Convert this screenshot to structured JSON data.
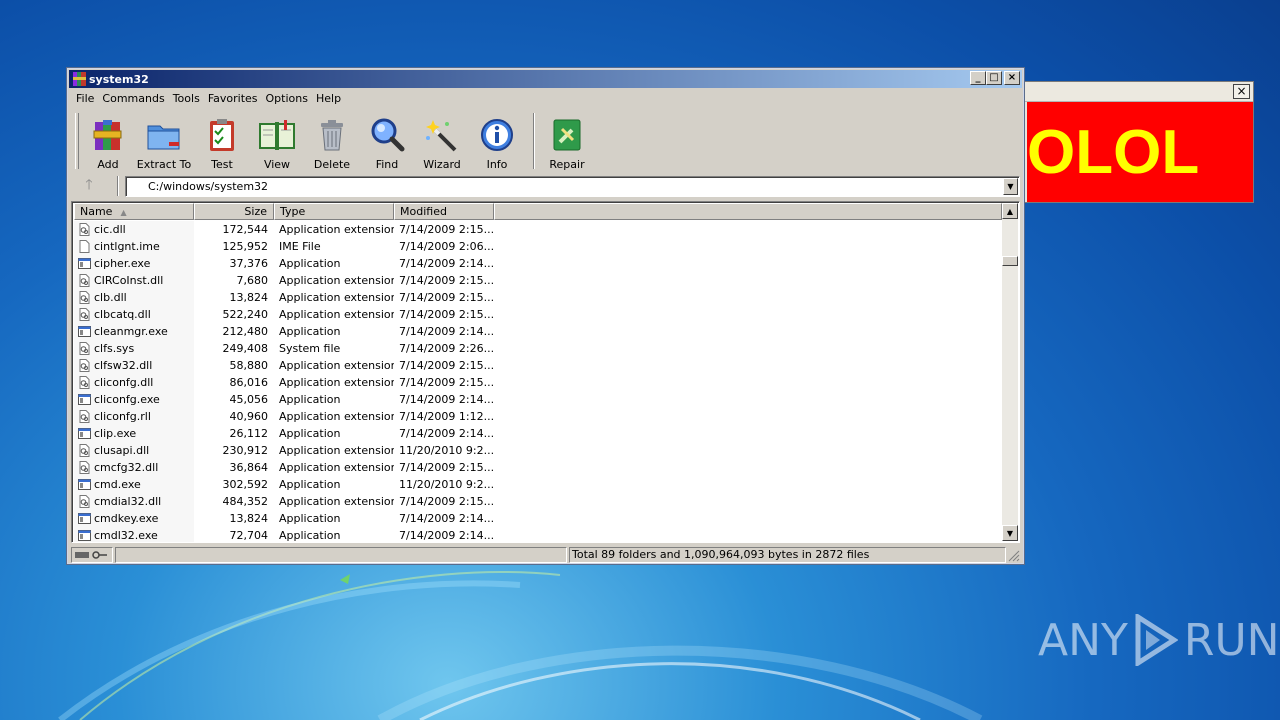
{
  "window": {
    "title": "system32",
    "minimize_glyph": "_",
    "maximize_glyph": "□",
    "close_glyph": "×"
  },
  "menu": [
    "File",
    "Commands",
    "Tools",
    "Favorites",
    "Options",
    "Help"
  ],
  "toolbar": {
    "buttons": [
      {
        "label": "Add",
        "icon": "add-archive-icon"
      },
      {
        "label": "Extract To",
        "icon": "extract-folder-icon"
      },
      {
        "label": "Test",
        "icon": "test-clipboard-icon"
      },
      {
        "label": "View",
        "icon": "view-book-icon"
      },
      {
        "label": "Delete",
        "icon": "delete-trash-icon"
      },
      {
        "label": "Find",
        "icon": "find-magnifier-icon"
      },
      {
        "label": "Wizard",
        "icon": "wizard-wand-icon"
      },
      {
        "label": "Info",
        "icon": "info-icon"
      },
      {
        "label": "Repair",
        "icon": "repair-kit-icon"
      }
    ]
  },
  "address": {
    "path": "C:/windows/system32",
    "up_glyph": "🡑"
  },
  "columns": {
    "name": "Name",
    "size": "Size",
    "type": "Type",
    "modified": "Modified"
  },
  "files": [
    {
      "name": "cic.dll",
      "size": "172,544",
      "type": "Application extension",
      "modified": "7/14/2009 2:15...",
      "icon": "dll"
    },
    {
      "name": "cintlgnt.ime",
      "size": "125,952",
      "type": "IME File",
      "modified": "7/14/2009 2:06...",
      "icon": "blank"
    },
    {
      "name": "cipher.exe",
      "size": "37,376",
      "type": "Application",
      "modified": "7/14/2009 2:14...",
      "icon": "exe"
    },
    {
      "name": "CIRCoInst.dll",
      "size": "7,680",
      "type": "Application extension",
      "modified": "7/14/2009 2:15...",
      "icon": "dll"
    },
    {
      "name": "clb.dll",
      "size": "13,824",
      "type": "Application extension",
      "modified": "7/14/2009 2:15...",
      "icon": "dll"
    },
    {
      "name": "clbcatq.dll",
      "size": "522,240",
      "type": "Application extension",
      "modified": "7/14/2009 2:15...",
      "icon": "dll"
    },
    {
      "name": "cleanmgr.exe",
      "size": "212,480",
      "type": "Application",
      "modified": "7/14/2009 2:14...",
      "icon": "exe"
    },
    {
      "name": "clfs.sys",
      "size": "249,408",
      "type": "System file",
      "modified": "7/14/2009 2:26...",
      "icon": "dll"
    },
    {
      "name": "clfsw32.dll",
      "size": "58,880",
      "type": "Application extension",
      "modified": "7/14/2009 2:15...",
      "icon": "dll"
    },
    {
      "name": "cliconfg.dll",
      "size": "86,016",
      "type": "Application extension",
      "modified": "7/14/2009 2:15...",
      "icon": "dll"
    },
    {
      "name": "cliconfg.exe",
      "size": "45,056",
      "type": "Application",
      "modified": "7/14/2009 2:14...",
      "icon": "exe"
    },
    {
      "name": "cliconfg.rll",
      "size": "40,960",
      "type": "Application extension",
      "modified": "7/14/2009 1:12...",
      "icon": "dll"
    },
    {
      "name": "clip.exe",
      "size": "26,112",
      "type": "Application",
      "modified": "7/14/2009 2:14...",
      "icon": "exe"
    },
    {
      "name": "clusapi.dll",
      "size": "230,912",
      "type": "Application extension",
      "modified": "11/20/2010 9:2...",
      "icon": "dll"
    },
    {
      "name": "cmcfg32.dll",
      "size": "36,864",
      "type": "Application extension",
      "modified": "7/14/2009 2:15...",
      "icon": "dll"
    },
    {
      "name": "cmd.exe",
      "size": "302,592",
      "type": "Application",
      "modified": "11/20/2010 9:2...",
      "icon": "exe"
    },
    {
      "name": "cmdial32.dll",
      "size": "484,352",
      "type": "Application extension",
      "modified": "7/14/2009 2:15...",
      "icon": "dll"
    },
    {
      "name": "cmdkey.exe",
      "size": "13,824",
      "type": "Application",
      "modified": "7/14/2009 2:14...",
      "icon": "exe"
    },
    {
      "name": "cmdl32.exe",
      "size": "72,704",
      "type": "Application",
      "modified": "7/14/2009 2:14...",
      "icon": "exe"
    }
  ],
  "status": {
    "text": "Total 89 folders and 1,090,964,093 bytes in 2872 files"
  },
  "popup": {
    "text": "OLOL",
    "close_glyph": "×"
  },
  "watermark": {
    "left": "ANY",
    "right": "RUN"
  }
}
